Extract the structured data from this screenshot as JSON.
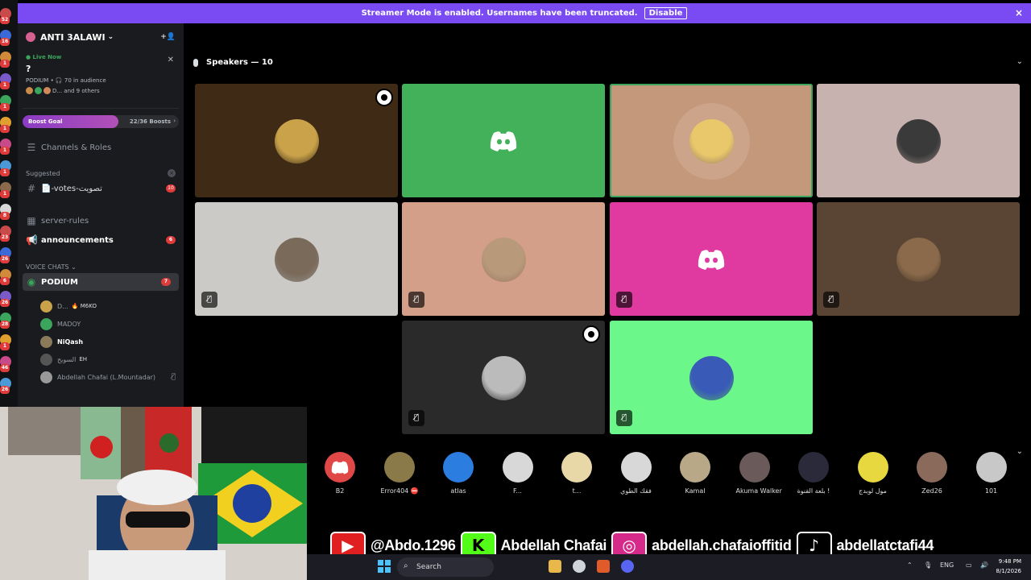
{
  "banner": {
    "text": "Streamer Mode is enabled. Usernames have been truncated.",
    "disable_label": "Disable",
    "close_icon": "×",
    "color": "#7a4bf2"
  },
  "server": {
    "name": "ANTI 3ALAWI",
    "chevron": "⌄",
    "add_member_icon": "+👤"
  },
  "live": {
    "tag": "● Live Now",
    "title": "?",
    "info": "PODIUM • 🎧 70 in audience",
    "others": "D... and 9 others",
    "close": "✕"
  },
  "boost": {
    "label": "Boost Goal",
    "count": "22/36 Boosts",
    "arrow": "›",
    "progress": 0.611
  },
  "channels_roles": "Channels & Roles",
  "suggested": {
    "label": "Suggested",
    "close": "×",
    "item": {
      "name": "📄-votes-تصويت",
      "badge": "10"
    }
  },
  "channels": [
    {
      "name": "server-rules",
      "icon": "▦",
      "badge": ""
    },
    {
      "name": "announcements",
      "icon": "📢",
      "badge": "6"
    }
  ],
  "voice": {
    "header": "VOICE CHATS ⌄",
    "podium": {
      "name": "PODIUM",
      "badge": "7",
      "sub": "?"
    },
    "users": [
      {
        "name": "D...",
        "extra": "🔥 M6KO",
        "bold": false,
        "muted": false,
        "color": "#c9a24a"
      },
      {
        "name": "MADOY",
        "extra": "",
        "bold": false,
        "muted": false,
        "color": "#3ba55d"
      },
      {
        "name": "NiQash",
        "extra": "",
        "bold": true,
        "muted": false,
        "color": "#8a7a5a"
      },
      {
        "name": "السويح",
        "extra": "EH",
        "bold": false,
        "muted": false,
        "color": "#555"
      },
      {
        "name": "Abdellah Chafai (L.Mountadar)",
        "extra": "",
        "bold": false,
        "muted": true,
        "color": "#999"
      }
    ]
  },
  "stage": {
    "speakers_label": "Speakers — 10",
    "chevron": "⌄",
    "mute_icon": "🎙̸"
  },
  "tiles": [
    {
      "bg": "#3f2b15",
      "avatar": "#c9a24a",
      "kind": "photo",
      "muted": false,
      "mod": true
    },
    {
      "bg": "#43b05a",
      "avatar": "",
      "kind": "discord",
      "muted": false,
      "mod": false
    },
    {
      "bg": "#c4987a",
      "avatar": "#e8c86a",
      "kind": "photo",
      "muted": false,
      "mod": false,
      "speaking": true
    },
    {
      "bg": "#c8b2b0",
      "avatar": "#3a3a3a",
      "kind": "photo",
      "muted": false,
      "mod": false
    },
    {
      "bg": "#cccac6",
      "avatar": "#7a6a5a",
      "kind": "photo",
      "muted": true,
      "mod": false
    },
    {
      "bg": "#d49f89",
      "avatar": "#b89a7a",
      "kind": "photo",
      "muted": true,
      "mod": false
    },
    {
      "bg": "#e03aa0",
      "avatar": "",
      "kind": "discord",
      "muted": true,
      "mod": false
    },
    {
      "bg": "#5a4535",
      "avatar": "#8a6a4a",
      "kind": "photo",
      "muted": true,
      "mod": false
    },
    {
      "bg": "#2a2a2a",
      "avatar": "#bbbbbb",
      "kind": "photo",
      "muted": true,
      "mod": true
    },
    {
      "bg": "#6bf789",
      "avatar": "#3a5ab8",
      "kind": "photo",
      "muted": true,
      "mod": false
    }
  ],
  "audience": [
    {
      "name": "B2",
      "color": "#e04848"
    },
    {
      "name": "Error404 ⛔",
      "color": "#8a7a4a"
    },
    {
      "name": "atlas",
      "color": "#2b7de0"
    },
    {
      "name": "F...",
      "color": "#d8d8d8"
    },
    {
      "name": "t...",
      "color": "#e8d8a8"
    },
    {
      "name": "فقك الطوي",
      "color": "#d8d8d8"
    },
    {
      "name": "Kamal",
      "color": "#b8a888"
    },
    {
      "name": "Akuma Walker",
      "color": "#6a5a5a"
    },
    {
      "name": "بلعة القنوة !",
      "color": "#2a2a3a"
    },
    {
      "name": "مول لوبدج",
      "color": "#e8d840"
    },
    {
      "name": "Zed26",
      "color": "#8a6a5a"
    },
    {
      "name": "101",
      "color": "#c8c8c8"
    }
  ],
  "socials": [
    {
      "icon": "▶",
      "color": "#e02020",
      "handle": "@Abdo.1296"
    },
    {
      "icon": "K",
      "color": "#53fc18",
      "handle": "Abdellah Chafai"
    },
    {
      "icon": "◎",
      "color": "#d62a8a",
      "handle": "abdellah.chafaioffitid"
    },
    {
      "icon": "♪",
      "color": "#000000",
      "handle": "abdellatctafi44"
    }
  ],
  "taskbar": {
    "search": "Search",
    "lang": "ENG",
    "time": "9:48 PM",
    "date": "8/1/2026"
  }
}
